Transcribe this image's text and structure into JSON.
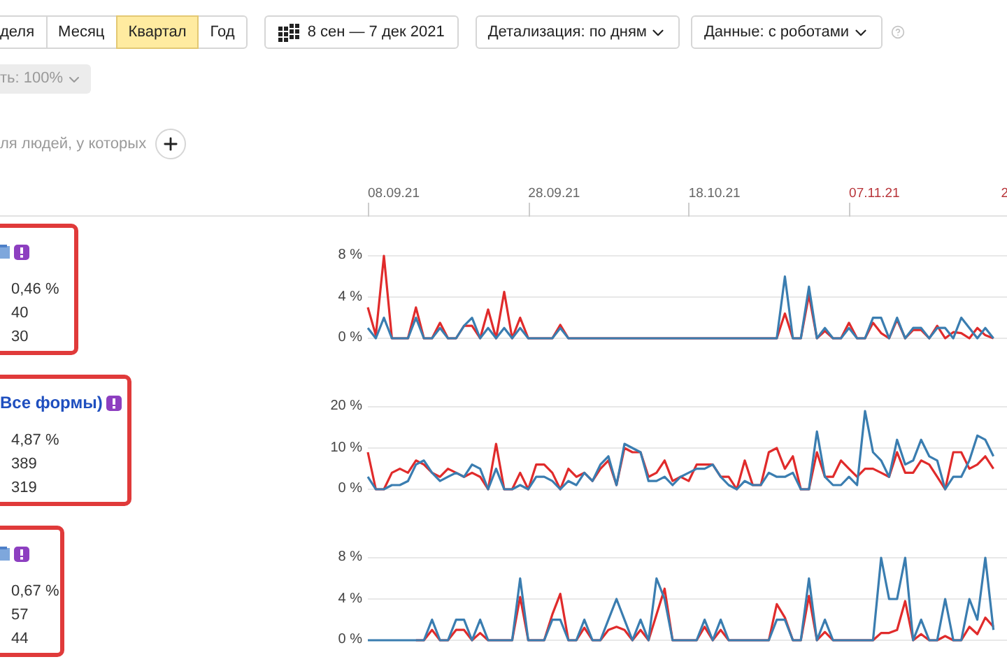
{
  "period_tabs": [
    {
      "label": "деля",
      "selected": false
    },
    {
      "label": "Месяц",
      "selected": false
    },
    {
      "label": "Квартал",
      "selected": true
    },
    {
      "label": "Год",
      "selected": false
    }
  ],
  "date_range": "8 сен — 7 дек 2021",
  "dropdowns": [
    "Детализация: по дням",
    "Данные: с роботами"
  ],
  "accuracy_button": "ть: 100%",
  "segment_hint": "ля людей, у которых",
  "date_axis": [
    {
      "label": "08.09.21",
      "weekend": false
    },
    {
      "label": "28.09.21",
      "weekend": false
    },
    {
      "label": "18.10.21",
      "weekend": false
    },
    {
      "label": "07.11.21",
      "weekend": true
    },
    {
      "label": "2",
      "weekend": true
    }
  ],
  "metrics": [
    {
      "page_icon": true,
      "values": [
        "0,46 %",
        "40",
        "30"
      ],
      "chart_data": {
        "type": "line",
        "ylim": [
          0,
          8
        ],
        "yticks": [
          {
            "value": 0,
            "label": "0 %"
          },
          {
            "value": 4,
            "label": "4 %"
          },
          {
            "value": 8,
            "label": "8 %"
          }
        ],
        "series": [
          {
            "color": "#e02b2b",
            "values": [
              3,
              0.3,
              8,
              0,
              0,
              0,
              3,
              0,
              0,
              1.5,
              0,
              0,
              1.2,
              1.2,
              0,
              2.8,
              0,
              4.5,
              0,
              2,
              0,
              0,
              0,
              0,
              1.3,
              0,
              0,
              0,
              0,
              0,
              0,
              0,
              0,
              0,
              0,
              0,
              0,
              0,
              0,
              0,
              0,
              0,
              0,
              0,
              0,
              0,
              0,
              0,
              0,
              0,
              0,
              0,
              2.4,
              0,
              0,
              4.2,
              0,
              0.7,
              0,
              0,
              1.5,
              0,
              0,
              1.5,
              0.5,
              0,
              1.8,
              0,
              0.8,
              0.8,
              0,
              1.2,
              0,
              0.6,
              0.5,
              0,
              1,
              0.3,
              0
            ]
          },
          {
            "color": "#3a7db0",
            "values": [
              1,
              0,
              2,
              0,
              0,
              0,
              2,
              0,
              0,
              1,
              0,
              0,
              1.2,
              2,
              0,
              1,
              0,
              1,
              0,
              1,
              0,
              0,
              0,
              0,
              1,
              0,
              0,
              0,
              0,
              0,
              0,
              0,
              0,
              0,
              0,
              0,
              0,
              0,
              0,
              0,
              0,
              0,
              0,
              0,
              0,
              0,
              0,
              0,
              0,
              0,
              0,
              0,
              6,
              0,
              0,
              5,
              0,
              1,
              0,
              0,
              1,
              0,
              0,
              2,
              2,
              0,
              2,
              0,
              1,
              1,
              0,
              1,
              1,
              0,
              2,
              1,
              0,
              1,
              0
            ]
          }
        ]
      }
    },
    {
      "page_icon": false,
      "title": "Все формы)",
      "values": [
        "4,87 %",
        "389",
        "319"
      ],
      "chart_data": {
        "type": "line",
        "ylim": [
          0,
          20
        ],
        "yticks": [
          {
            "value": 0,
            "label": "0 %"
          },
          {
            "value": 10,
            "label": "10 %"
          },
          {
            "value": 20,
            "label": "20 %"
          }
        ],
        "series": [
          {
            "color": "#e02b2b",
            "values": [
              9,
              0,
              0,
              4,
              5,
              4,
              7,
              6,
              4,
              3,
              5,
              4,
              3,
              4,
              3,
              0,
              11,
              0,
              0,
              4,
              0,
              6,
              6,
              4,
              0,
              5,
              3,
              4,
              2,
              5,
              7,
              1,
              10,
              9,
              9,
              3,
              4,
              7,
              2,
              3,
              2,
              6,
              6,
              6,
              3,
              3,
              0,
              7,
              1,
              1,
              9,
              10,
              5,
              8,
              0,
              0,
              9,
              3,
              3,
              7,
              5,
              3,
              5,
              5,
              4,
              3,
              9,
              4,
              4,
              7,
              6,
              3,
              0,
              9,
              9,
              5,
              6,
              8,
              5
            ]
          },
          {
            "color": "#3a7db0",
            "values": [
              3,
              0,
              0,
              1,
              1,
              2,
              6,
              7,
              4,
              2,
              3,
              4,
              3,
              6,
              5,
              0,
              5,
              0,
              0,
              1,
              0,
              3,
              3,
              2,
              0,
              2,
              1,
              4,
              2,
              6,
              8,
              1,
              11,
              10,
              9,
              2,
              2,
              3,
              1,
              3,
              4,
              5,
              5,
              6,
              3,
              1,
              0,
              2,
              1,
              1,
              4,
              3,
              3,
              4,
              0,
              0,
              14,
              3,
              1,
              1,
              3,
              1,
              19,
              9,
              7,
              3,
              12,
              6,
              7,
              12,
              8,
              7,
              0,
              3,
              3,
              7,
              13,
              12,
              8
            ]
          }
        ]
      }
    },
    {
      "page_icon": true,
      "values": [
        "0,67 %",
        "57",
        "44"
      ],
      "chart_data": {
        "type": "line",
        "ylim": [
          0,
          8
        ],
        "yticks": [
          {
            "value": 0,
            "label": "0 %"
          },
          {
            "value": 4,
            "label": "4 %"
          },
          {
            "value": 8,
            "label": "8 %"
          }
        ],
        "series": [
          {
            "color": "#e02b2b",
            "values": [
              null,
              null,
              null,
              null,
              null,
              null,
              0,
              0,
              1,
              0,
              0,
              1,
              1,
              0,
              0.7,
              0,
              0,
              0,
              0,
              4.2,
              0,
              0,
              0,
              2.5,
              4.5,
              0,
              0,
              1.2,
              0,
              0,
              1,
              1.3,
              1,
              0,
              1,
              0,
              2.5,
              5,
              0,
              0,
              0,
              0,
              1.3,
              0,
              1,
              0,
              0,
              0,
              0,
              0,
              0,
              3.5,
              2.2,
              0,
              0,
              4.3,
              0,
              0.8,
              0,
              0,
              0,
              0,
              0,
              0,
              0.7,
              0.7,
              1,
              3.8,
              0,
              0.6,
              0,
              0,
              0.4,
              0,
              0,
              1.3,
              0.6,
              2.2,
              1.3
            ]
          },
          {
            "color": "#3a7db0",
            "values": [
              0,
              0,
              0,
              0,
              0,
              0,
              0,
              0,
              2,
              0,
              0,
              2,
              2,
              0,
              2,
              0,
              0,
              0,
              0,
              6,
              0,
              0,
              0,
              2,
              2,
              0,
              0,
              2,
              0,
              0,
              2,
              4,
              2,
              0,
              2,
              0,
              6,
              4,
              0,
              0,
              0,
              0,
              2,
              0,
              2,
              0,
              0,
              0,
              0,
              0,
              0,
              2,
              2,
              0,
              0,
              6,
              0,
              2,
              0,
              0,
              0,
              0,
              0,
              0,
              8,
              4,
              4,
              8,
              0,
              2,
              0,
              0,
              4,
              0,
              0,
              4,
              2,
              8,
              1
            ]
          }
        ]
      }
    }
  ]
}
